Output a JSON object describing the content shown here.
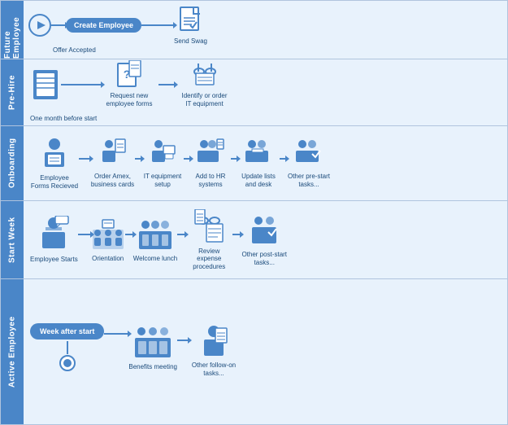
{
  "lanes": [
    {
      "id": "future-employee",
      "label": "Future Employee",
      "nodes": [
        {
          "id": "play",
          "type": "play",
          "label": ""
        },
        {
          "id": "create-employee",
          "type": "rect",
          "label": "Create Employee"
        },
        {
          "id": "send-swag",
          "type": "doc",
          "label": "Send Swag"
        }
      ],
      "sublabels": [
        "Offer Accepted",
        "Send Swag"
      ]
    },
    {
      "id": "pre-hire",
      "label": "Pre-Hire",
      "nodes": [
        {
          "id": "db-shape",
          "type": "db",
          "label": ""
        },
        {
          "id": "request-forms",
          "type": "question-doc",
          "label": "Request new employee forms"
        },
        {
          "id": "identify-it",
          "type": "glasses-doc",
          "label": "Identify or order IT equipment"
        }
      ],
      "sublabels": [
        "One month before start"
      ]
    },
    {
      "id": "onboarding",
      "label": "Onboarding",
      "nodes": [
        {
          "id": "emp-forms",
          "type": "person-doc",
          "label": "Employee Forms Recieved"
        },
        {
          "id": "order-amex",
          "type": "person-cards",
          "label": "Order Amex, business cards"
        },
        {
          "id": "it-setup",
          "type": "person-computer",
          "label": "IT equipment setup"
        },
        {
          "id": "add-hr",
          "type": "persons-doc",
          "label": "Add to HR systems"
        },
        {
          "id": "update-lists",
          "type": "persons-desk",
          "label": "Update lists and desk"
        },
        {
          "id": "pre-start",
          "type": "persons-check",
          "label": "Other pre-start tasks..."
        }
      ]
    },
    {
      "id": "start-week",
      "label": "Start Week",
      "nodes": [
        {
          "id": "emp-starts",
          "type": "person-present",
          "label": "Employee Starts"
        },
        {
          "id": "orientation",
          "type": "group-present",
          "label": "Orientation"
        },
        {
          "id": "welcome-lunch",
          "type": "group-table",
          "label": "Welcome lunch"
        },
        {
          "id": "review-expense",
          "type": "glasses-doc2",
          "label": "Review expense procedures"
        },
        {
          "id": "post-start",
          "type": "persons-check2",
          "label": "Other post-start tasks..."
        }
      ]
    },
    {
      "id": "active-employee",
      "label": "Active Employee",
      "nodes": [
        {
          "id": "week-after",
          "type": "rounded-rect",
          "label": "Week after start"
        },
        {
          "id": "benefits",
          "type": "group-large",
          "label": "Benefits meeting"
        },
        {
          "id": "follow-on",
          "type": "person-doc2",
          "label": "Other follow-on tasks..."
        },
        {
          "id": "end",
          "type": "end-circle",
          "label": ""
        }
      ]
    }
  ],
  "colors": {
    "primary": "#4a86c8",
    "bg": "#e8f2fc",
    "text": "#1a4a7a",
    "lane-label": "#4a86c8",
    "border": "#b0c4de"
  }
}
